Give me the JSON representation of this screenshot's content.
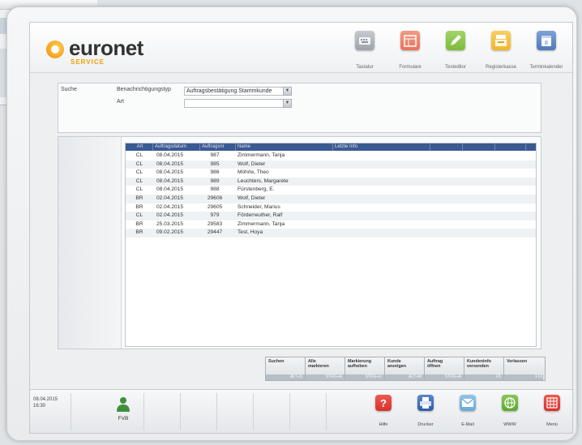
{
  "logo": {
    "brand": "euronet",
    "sub": "SERVICE"
  },
  "toolbar": [
    {
      "name": "tool-tastatur",
      "label": "Tastatur",
      "icon": "keyboard-icon",
      "color": "#9da4ab"
    },
    {
      "name": "tool-formulare",
      "label": "Formulare",
      "icon": "forms-icon",
      "color": "#e8735a"
    },
    {
      "name": "tool-texteditor",
      "label": "Texteditor",
      "icon": "pencil-icon",
      "color": "#7dbb3a"
    },
    {
      "name": "tool-registerkasse",
      "label": "Registerkasse",
      "icon": "register-icon",
      "color": "#f1b72b"
    },
    {
      "name": "tool-terminkalender",
      "label": "Terminkalender",
      "icon": "calendar-icon",
      "color": "#4f7ab8"
    }
  ],
  "search": {
    "title": "Suche",
    "type_label": "Benachrichtigungstyp",
    "type_value": "Auftragsbestätigung Stammkunde",
    "art_label": "Art",
    "art_value": ""
  },
  "grid": {
    "columns": [
      "Art",
      "Auftragsdatum",
      "Auftragsnr",
      "Name",
      "Letzte Info"
    ],
    "rows": [
      {
        "art": "CL",
        "datum": "08.04.2015",
        "nr": "987",
        "name": "Zimmermann, Tanja"
      },
      {
        "art": "CL",
        "datum": "08.04.2015",
        "nr": "985",
        "name": "Wolf, Dieter"
      },
      {
        "art": "CL",
        "datum": "08.04.2015",
        "nr": "986",
        "name": "Möhrle, Theo"
      },
      {
        "art": "CL",
        "datum": "08.04.2015",
        "nr": "989",
        "name": "Leuchters, Margarete"
      },
      {
        "art": "CL",
        "datum": "08.04.2015",
        "nr": "988",
        "name": "Fürstenberg, E."
      },
      {
        "art": "BR",
        "datum": "02.04.2015",
        "nr": "29606",
        "name": "Wolf, Dieter"
      },
      {
        "art": "BR",
        "datum": "02.04.2015",
        "nr": "29605",
        "name": "Schneider, Marius"
      },
      {
        "art": "CL",
        "datum": "02.04.2015",
        "nr": "979",
        "name": "Förderreuther, Ralf"
      },
      {
        "art": "BR",
        "datum": "25.03.2015",
        "nr": "29583",
        "name": "Zimmermann, Tanja"
      },
      {
        "art": "BR",
        "datum": "09.02.2015",
        "nr": "29447",
        "name": "Test, Hoya"
      }
    ]
  },
  "actions": [
    {
      "name": "suchen-button",
      "label": "Suchen",
      "key": "ALT+S"
    },
    {
      "name": "alle-markieren-button",
      "label": "Alle markieren",
      "key": "STRG+A"
    },
    {
      "name": "markierung-aufheben-button",
      "label": "Markierung aufheben",
      "key": "STRG+U"
    },
    {
      "name": "kunde-anzeigen-button",
      "label": "Kunde anzeigen",
      "key": "ALT+M"
    },
    {
      "name": "auftrag-oeffnen-button",
      "label": "Auftrag öffnen",
      "key": "STRG+A"
    },
    {
      "name": "kundeninfo-versenden-button",
      "label": "Kundeninfo versenden",
      "key": "F5"
    },
    {
      "name": "verlassen-button",
      "label": "Verlassen",
      "key": "F10"
    }
  ],
  "status": {
    "date": "08.04.2015",
    "time": "16:30",
    "user": "FVB"
  },
  "bottom_tools": [
    {
      "name": "tool-hilfe",
      "label": "Hilfe",
      "icon": "help-icon",
      "color": "#d9312b"
    },
    {
      "name": "tool-drucker",
      "label": "Drucker",
      "icon": "printer-icon",
      "color": "#2f5da8"
    },
    {
      "name": "tool-email",
      "label": "E-Mail",
      "icon": "mail-icon",
      "color": "#6aa9d8"
    },
    {
      "name": "tool-www",
      "label": "WWW",
      "icon": "globe-icon",
      "color": "#5ea832"
    },
    {
      "name": "tool-menu",
      "label": "Menü",
      "icon": "menu-icon",
      "color": "#d9312b"
    }
  ]
}
